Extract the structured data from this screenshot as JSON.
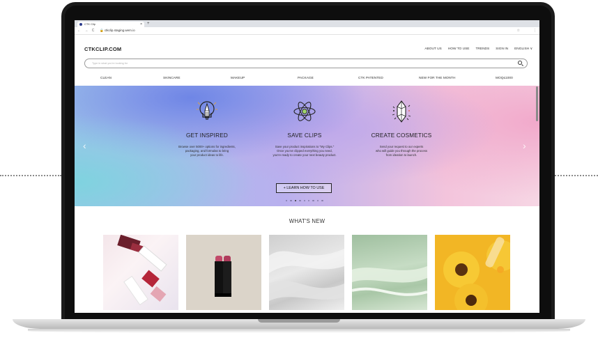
{
  "browser": {
    "tab_title": "CTK Clip",
    "tab_close": "×",
    "new_tab": "+",
    "nav_buttons": "← → C",
    "url": "ctkclip.staging.wem.io",
    "bookmark_icon": "star-icon",
    "menu_icon": "kebab-icon"
  },
  "site": {
    "logo": "CTKCLIP.COM",
    "top_nav": [
      "ABOUT US",
      "HOW TO USE",
      "TRENDS",
      "SIGN IN",
      "ENGLISH ∨"
    ],
    "search_placeholder": "Type in what you're looking for",
    "categories": [
      "CLEAN",
      "SKINCARE",
      "MAKEUP",
      "PACKAGE",
      "CTK PATENTED",
      "NEW FOR THE MONTH",
      "MOQ≤1000"
    ]
  },
  "hero": {
    "prev_arrow": "‹",
    "next_arrow": "›",
    "columns": [
      {
        "icon": "lightbulb-pencil-icon",
        "title": "GET INSPIRED",
        "lines": [
          "Browse over 5000+ options for ingredients,",
          "packaging, and formulas to bring",
          "your product ideas to life."
        ]
      },
      {
        "icon": "atom-icon",
        "title": "SAVE CLIPS",
        "lines": [
          "Save your product inspirations to \"My Clips.\"",
          "Once you've clipped everything you need,",
          "you're ready to create your next beauty product."
        ]
      },
      {
        "icon": "crystal-icon",
        "title": "CREATE COSMETICS",
        "lines": [
          "Send your request to our experts",
          "who will guide you through the process",
          "from ideation to launch."
        ]
      }
    ],
    "cta": "+ LEARN HOW TO USE",
    "pager_count": 9,
    "pager_active": 2
  },
  "whats_new": {
    "title": "WHAT'S NEW"
  },
  "colors": {
    "hero_blue": "#6f86e6",
    "hero_teal": "#7fd3df",
    "hero_pink": "#f1a9cb",
    "text_dark": "#1e1e1e"
  }
}
